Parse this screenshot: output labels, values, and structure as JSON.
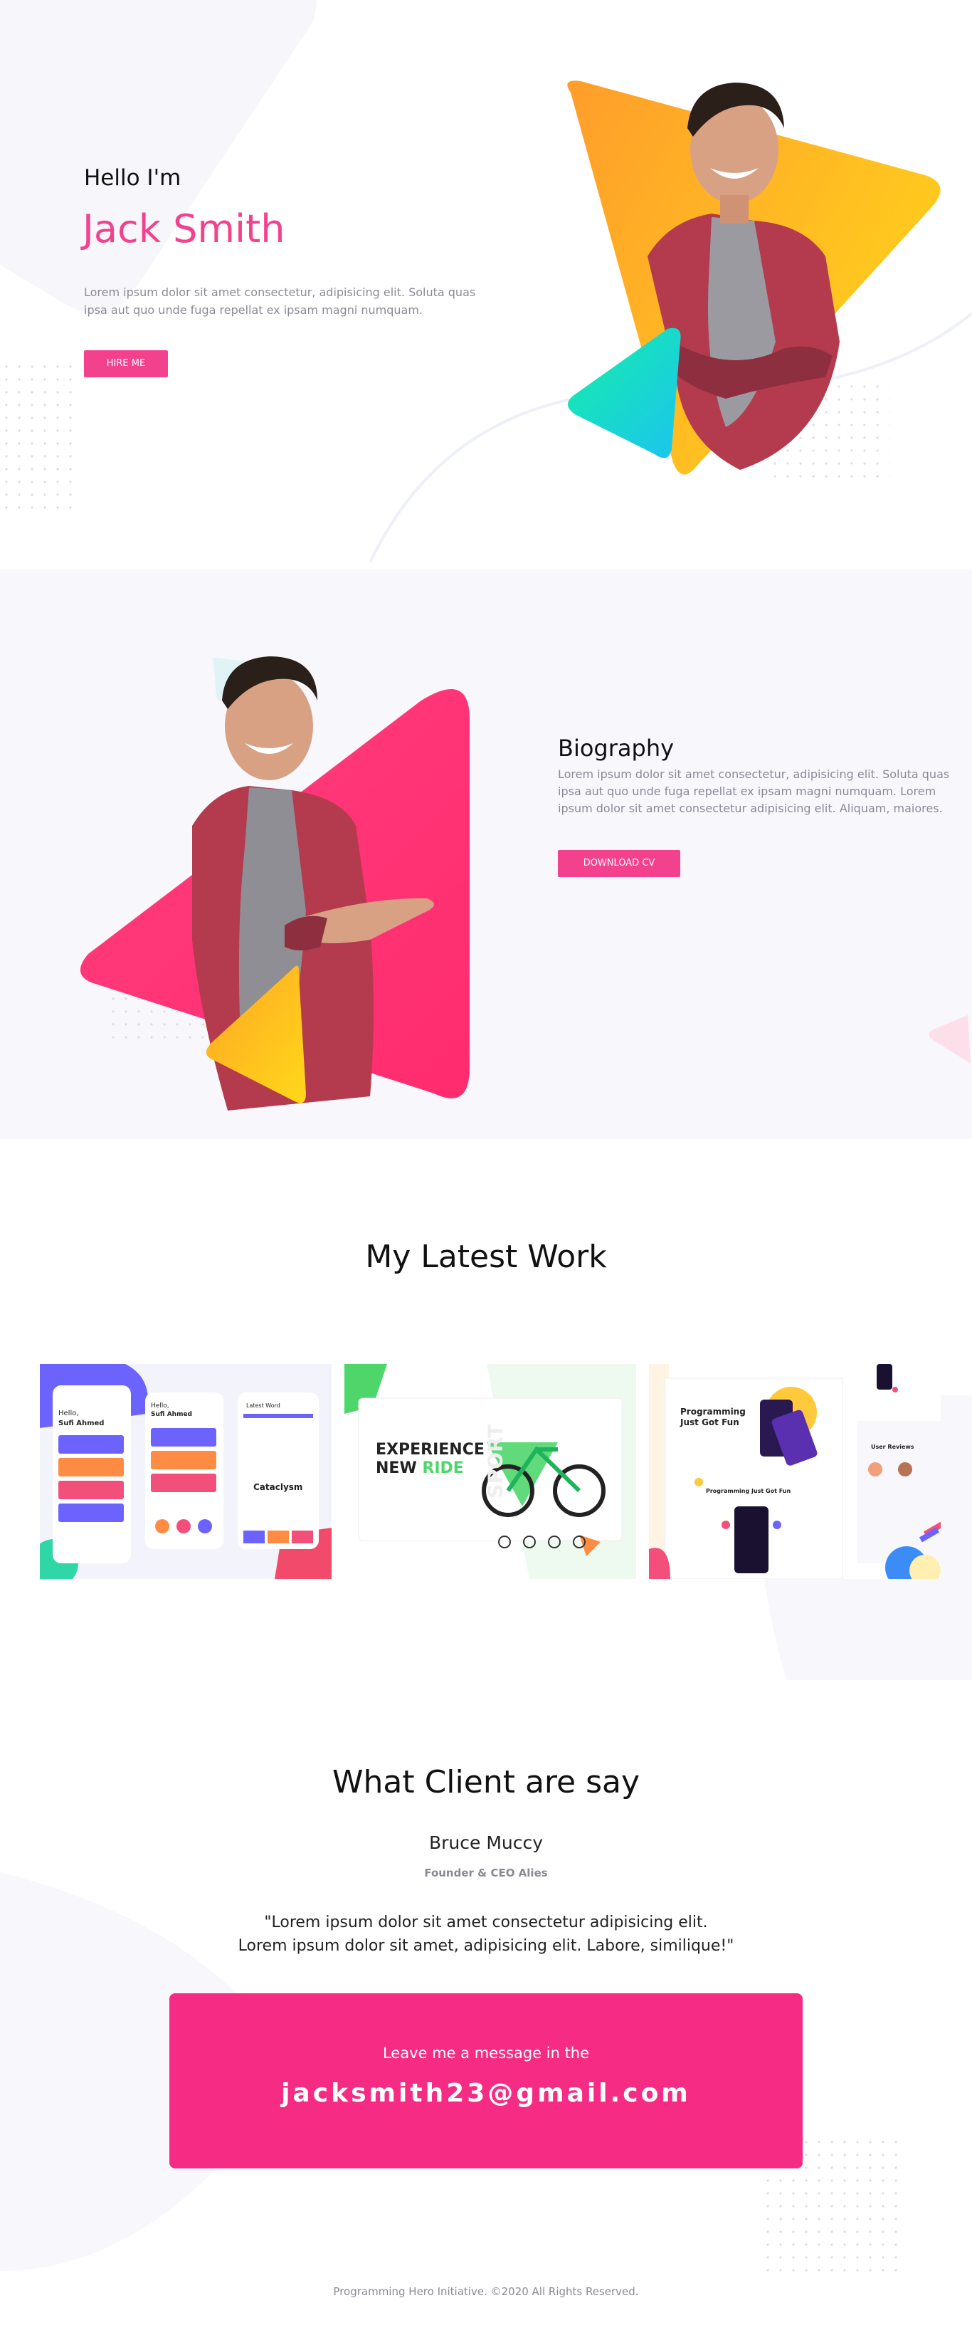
{
  "hero": {
    "greeting": "Hello I'm",
    "name": "Jack Smith",
    "description": "Lorem ipsum dolor sit amet consectetur, adipisicing elit. Soluta quas ipsa aut quo unde fuga repellat ex ipsam magni numquam.",
    "hire_label": "HIRE ME"
  },
  "biography": {
    "title": "Biography",
    "text": "Lorem ipsum dolor sit amet consectetur, adipisicing elit. Soluta quas ipsa aut quo unde fuga repellat ex ipsam magni numquam. Lorem ipsum dolor sit amet consectetur adipisicing elit. Aliquam, maiores.",
    "cv_label": "DOWNLOAD CV"
  },
  "work": {
    "title": "My Latest Work",
    "items": [
      {
        "kind": "mobile-app",
        "screens": [
          {
            "greeting": "Hello,",
            "user": "Sufi Ahmed"
          },
          {
            "greeting": "Hello,",
            "user": "Sufi Ahmed"
          },
          {
            "heading": "Latest Word",
            "word": "Cataclysm"
          }
        ]
      },
      {
        "kind": "bike-landing",
        "headline_1": "EXPERIENCE",
        "headline_2": "NEW",
        "headline_3": "RIDE",
        "side_word": "SPORT"
      },
      {
        "kind": "web-app",
        "headline": "Programming Just Got Fun",
        "sub_heading": "Programming Just Got Fun",
        "panel_title": "User Reviews"
      }
    ]
  },
  "clients": {
    "title": "What Client are say",
    "name": "Bruce Muccy",
    "role": "Founder & CEO Alies",
    "quote_line_1": "\"Lorem ipsum dolor sit amet consectetur adipisicing elit.",
    "quote_line_2": "Lorem ipsum dolor sit amet, adipisicing elit. Labore, similique!\""
  },
  "contact": {
    "lead": "Leave me a message in the",
    "email": "jacksmith23@gmail.com"
  },
  "footer": {
    "copyright": "Programming Hero Initiative. ©2020 All Rights Reserved."
  },
  "colors": {
    "pink": "#f4418d",
    "contact_pink": "#f62c84",
    "orange": "#ffa130",
    "yellow": "#ffd21f",
    "teal": "#12e2be"
  }
}
